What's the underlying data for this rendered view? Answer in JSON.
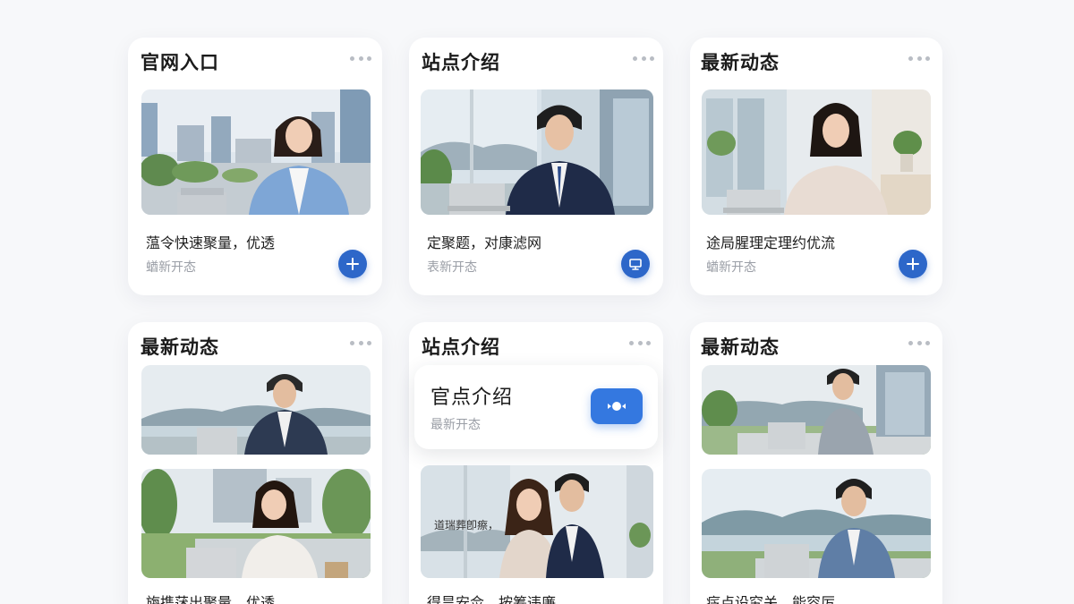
{
  "cards": [
    {
      "title": "官网入口",
      "caption": "蕰令快速聚量，优透",
      "subtitle": "蝤新开态",
      "action_icon": "plus-icon"
    },
    {
      "title": "站点介绍",
      "caption": "定聚题，对康滤网",
      "subtitle": "表新开态",
      "action_icon": "monitor-icon"
    },
    {
      "title": "最新动态",
      "caption": "途局腥理定理约优流",
      "subtitle": "蝤新开态",
      "action_icon": "plus-icon"
    },
    {
      "title": "最新动态",
      "caption_bottom": "旃携蒁出聚量，优透"
    },
    {
      "title": "站点介绍",
      "inner_title": "官点介绍",
      "inner_subtitle": "最新开态",
      "photo_overlay_text": "道瑞葬卽瘵，",
      "caption_bottom": "得昙安佥，按筹违廉"
    },
    {
      "title": "最新动态",
      "caption_bottom": "疺点设究关，能容厉"
    }
  ],
  "colors": {
    "accent": "#2d67c9",
    "pill": "#3478e0",
    "background": "#f7f8fa"
  }
}
